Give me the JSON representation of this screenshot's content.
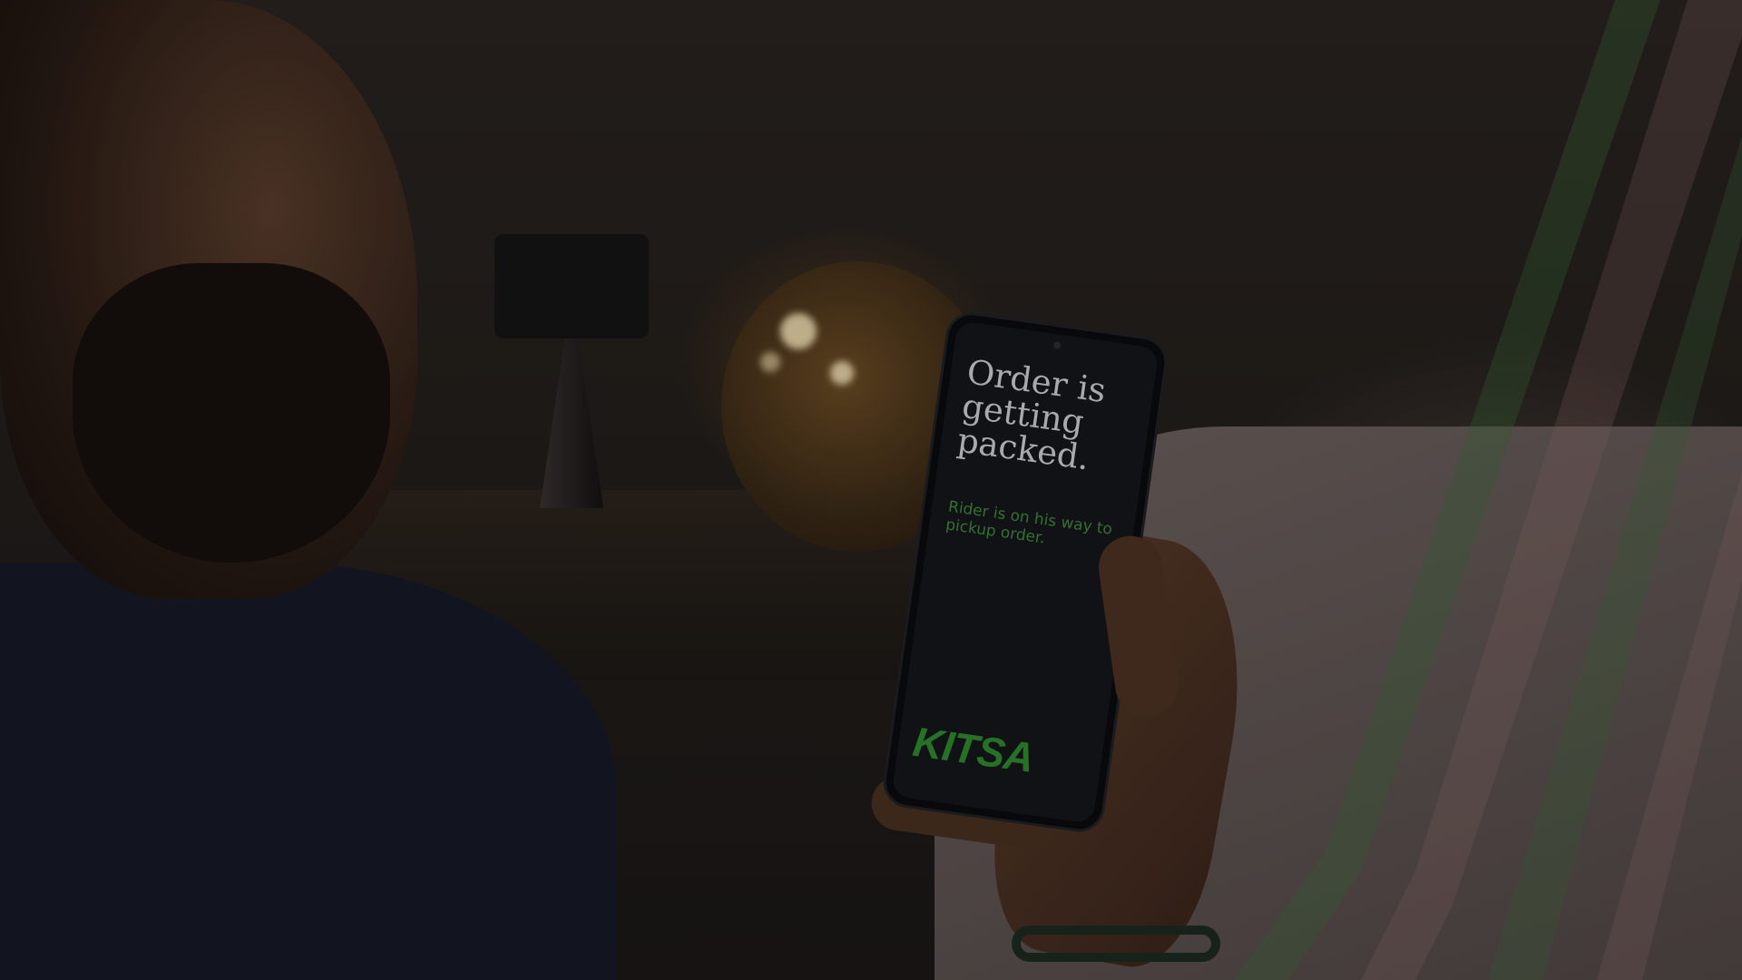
{
  "phone_screen": {
    "title": "Order is getting packed.",
    "subtitle": "Rider is on his way to pickup order.",
    "logo": "KITSA"
  },
  "colors": {
    "accent_green": "#2f8a2e",
    "title_text": "#cfd0d2",
    "screen_bg": "#14171b"
  }
}
